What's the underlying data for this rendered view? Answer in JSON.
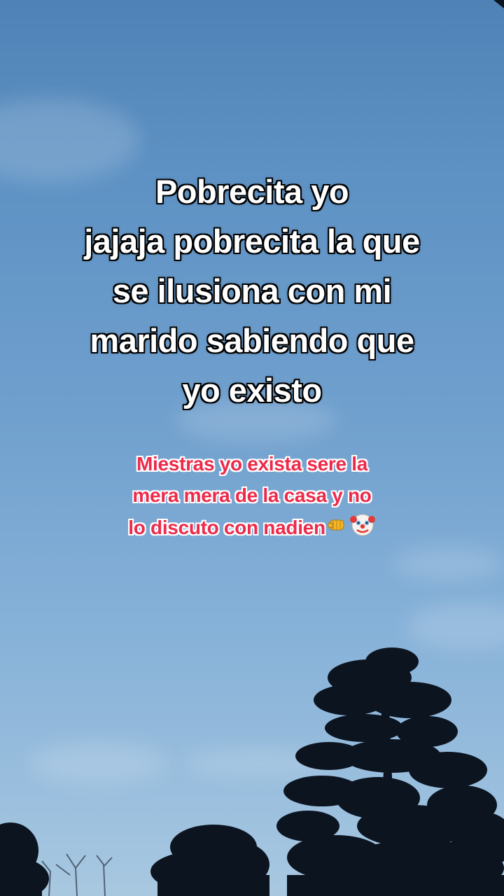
{
  "overlay": {
    "main_caption": {
      "lines": [
        "Pobrecita yo",
        "jajaja pobrecita la que",
        "se ilusiona con mi",
        "marido sabiendo que",
        "yo existo"
      ]
    },
    "sub_caption": {
      "lines": [
        "Miestras yo exista sere la",
        "mera mera de la casa y no",
        "lo discuto con nadien"
      ],
      "emojis": [
        "fist-bump-icon",
        "clown-face-icon"
      ]
    }
  },
  "colors": {
    "main_text": "#ffffff",
    "main_outline": "#000000",
    "sub_text": "#ee2a4a",
    "sub_outline": "#ffffff",
    "sky_top": "#4f82b6",
    "sky_bottom": "#a9c8e0",
    "trees": "#0c1420"
  }
}
